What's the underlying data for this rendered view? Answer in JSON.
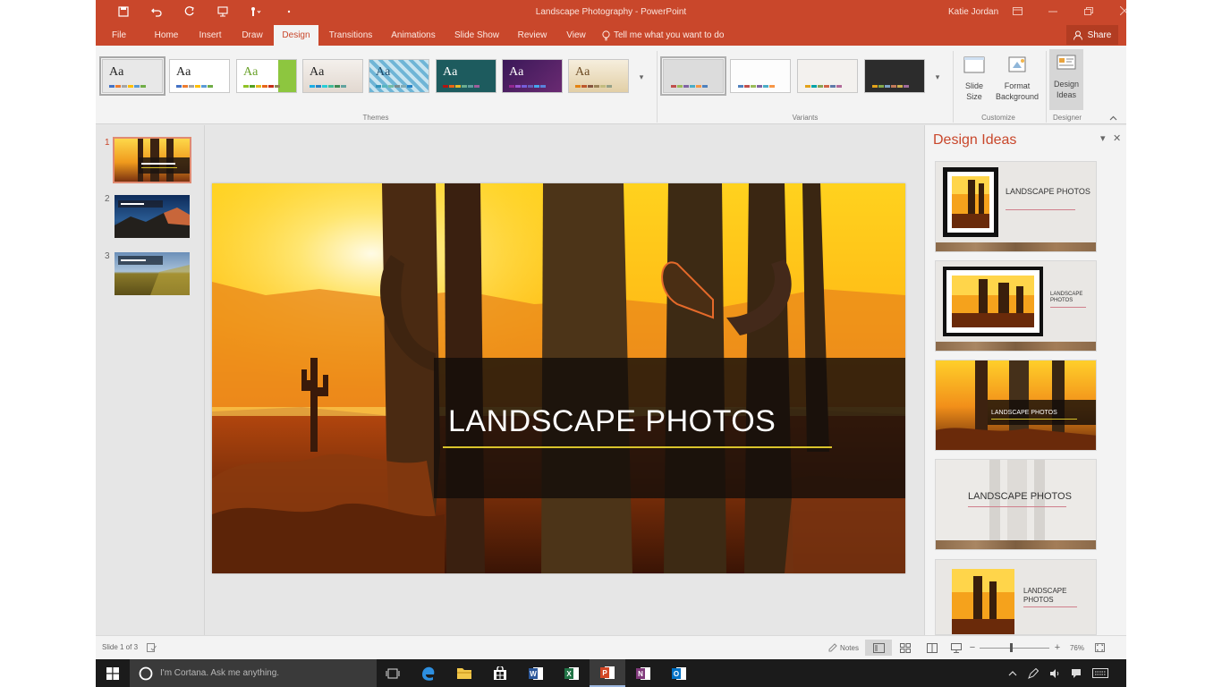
{
  "window": {
    "title": "Landscape Photography - PowerPoint",
    "user": "Katie Jordan"
  },
  "tabs": [
    {
      "label": "File"
    },
    {
      "label": "Home"
    },
    {
      "label": "Insert"
    },
    {
      "label": "Draw"
    },
    {
      "label": "Design"
    },
    {
      "label": "Transitions"
    },
    {
      "label": "Animations"
    },
    {
      "label": "Slide Show"
    },
    {
      "label": "Review"
    },
    {
      "label": "View"
    }
  ],
  "tell_me": "Tell me what you want to do",
  "share_label": "Share",
  "ribbon": {
    "themes_label": "Themes",
    "variants_label": "Variants",
    "customize_label": "Customize",
    "designer_label": "Designer",
    "theme_sample_text": "Aa",
    "slide_size_label_1": "Slide",
    "slide_size_label_2": "Size",
    "format_bg_label_1": "Format",
    "format_bg_label_2": "Background",
    "design_ideas_label_1": "Design",
    "design_ideas_label_2": "Ideas"
  },
  "slides": [
    {
      "number": "1"
    },
    {
      "number": "2"
    },
    {
      "number": "3"
    }
  ],
  "slide": {
    "title": "LANDSCAPE PHOTOS"
  },
  "design_ideas": {
    "title": "Design Ideas",
    "items": [
      {
        "text": "LANDSCAPE PHOTOS"
      },
      {
        "text": "LANDSCAPE PHOTOS"
      },
      {
        "text": "LANDSCAPE PHOTOS"
      },
      {
        "text": "LANDSCAPE PHOTOS"
      },
      {
        "text": "LANDSCAPE PHOTOS"
      }
    ]
  },
  "status": {
    "slide_count": "Slide 1 of 3",
    "notes_label": "Notes",
    "zoom": "76%"
  },
  "taskbar": {
    "cortana_placeholder": "I'm Cortana. Ask me anything."
  },
  "colors": {
    "accent": "#c9472b",
    "ribbon_bg": "#f3f3f3",
    "title_underline": "#d9c32b"
  }
}
